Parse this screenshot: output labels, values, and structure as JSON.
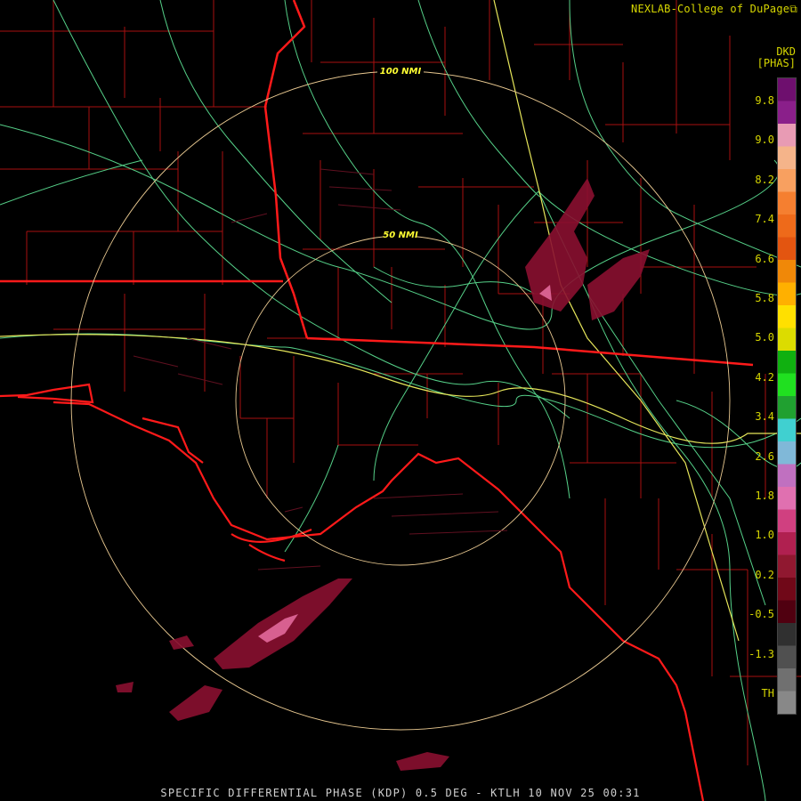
{
  "credit": "NEXLAB-College of DuPage",
  "credit_icon": "external-link-icon",
  "product_code": "DKD",
  "product_unit": "[PHAS]",
  "ring_labels": {
    "inner": "50 NMI",
    "outer": "100 NMI"
  },
  "legend": {
    "ticks": [
      "9.8",
      "9.0",
      "8.2",
      "7.4",
      "6.6",
      "5.8",
      "5.0",
      "4.2",
      "3.4",
      "2.6",
      "1.8",
      "1.0",
      "0.2",
      "-0.5",
      "-1.3",
      "TH"
    ],
    "colors": [
      "#6e0f6e",
      "#8a1f8a",
      "#e89bb4",
      "#f5b48a",
      "#f8a060",
      "#f57f30",
      "#ee6a1a",
      "#e35510",
      "#f08808",
      "#ffb000",
      "#ffe000",
      "#dcdc00",
      "#10b010",
      "#20e020",
      "#20a030",
      "#40d0d0",
      "#80b8d8",
      "#c070c0",
      "#e070b0",
      "#d04080",
      "#b02050",
      "#901830",
      "#700818",
      "#500010",
      "#303030",
      "#505050",
      "#707070",
      "#888888"
    ]
  },
  "footer": "SPECIFIC DIFFERENTIAL PHASE (KDP) 0.5 DEG - KTLH 10 NOV 25 00:31",
  "colors": {
    "label": "#d6d600",
    "county": "#b01212",
    "state": "#ff1a1a",
    "highway": "#59d98a",
    "interstate": "#e8e860",
    "ring": "#e8c890"
  }
}
